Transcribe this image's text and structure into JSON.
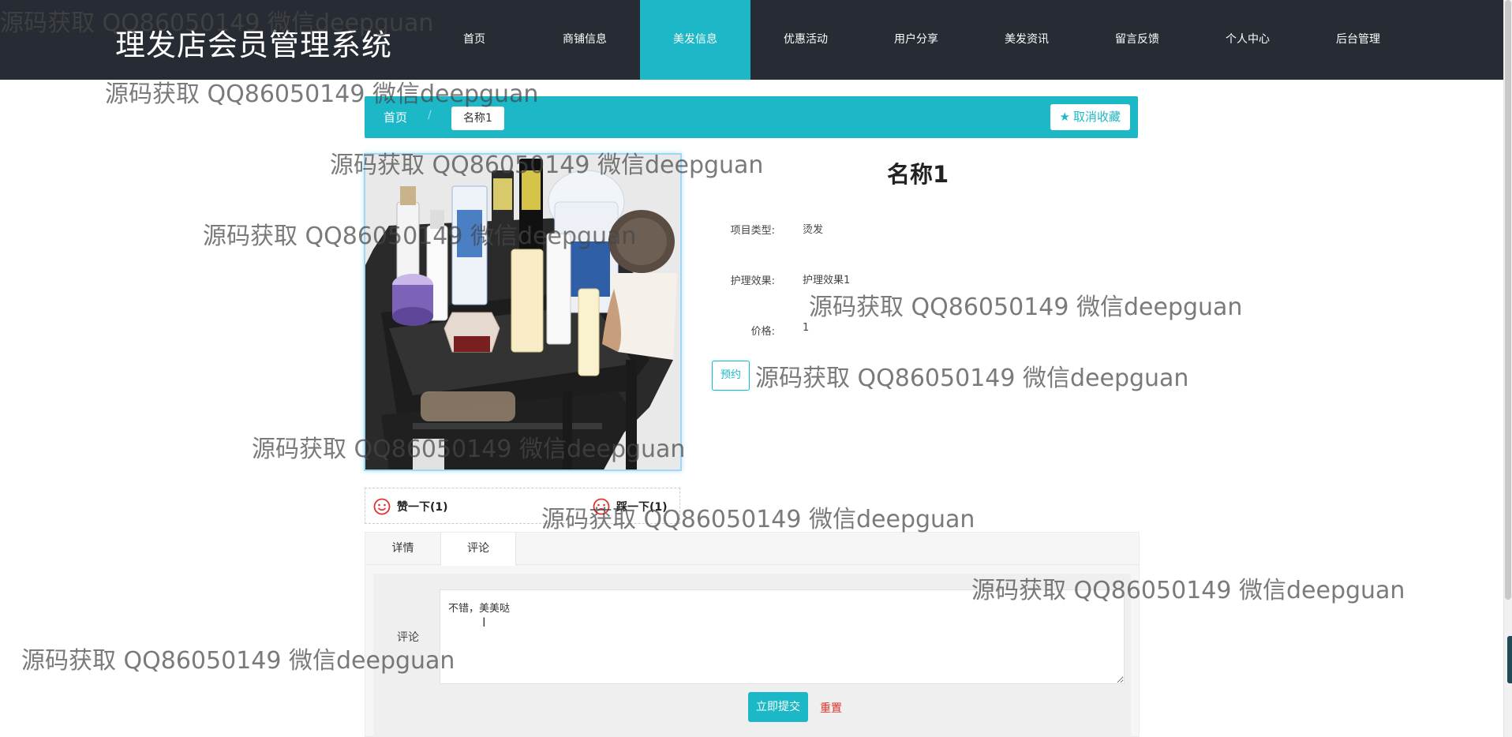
{
  "site": {
    "title": "理发店会员管理系统"
  },
  "nav": {
    "items": [
      {
        "label": "首页",
        "active": false
      },
      {
        "label": "商铺信息",
        "active": false
      },
      {
        "label": "美发信息",
        "active": true
      },
      {
        "label": "优惠活动",
        "active": false
      },
      {
        "label": "用户分享",
        "active": false
      },
      {
        "label": "美发资讯",
        "active": false
      },
      {
        "label": "留言反馈",
        "active": false
      },
      {
        "label": "个人中心",
        "active": false
      },
      {
        "label": "后台管理",
        "active": false
      }
    ]
  },
  "breadcrumb": {
    "home": "首页",
    "separator": "/",
    "current": "名称1"
  },
  "favorite": {
    "label": "取消收藏",
    "icon": "star-icon"
  },
  "product": {
    "name": "名称1",
    "fields": [
      {
        "label": "项目类型:",
        "value": "烫发"
      },
      {
        "label": "护理效果:",
        "value": "护理效果1"
      },
      {
        "label": "价格:",
        "value": "1"
      }
    ],
    "book_label": "预约"
  },
  "votes": {
    "like": {
      "label": "赞一下(1)",
      "icon": "smile-icon"
    },
    "dislike": {
      "label": "踩一下(1)",
      "icon": "frown-icon"
    }
  },
  "tabs": {
    "items": [
      {
        "label": "详情",
        "active": false
      },
      {
        "label": "评论",
        "active": true
      }
    ]
  },
  "comment": {
    "label": "评论",
    "value": "不错，美美哒",
    "submit_label": "立即提交",
    "reset_label": "重置"
  },
  "watermark": {
    "text": "源码获取 QQ86050149 微信deepguan"
  },
  "colors": {
    "accent": "#1cb8c8",
    "topbar": "#272b33",
    "danger": "#e0332c"
  }
}
